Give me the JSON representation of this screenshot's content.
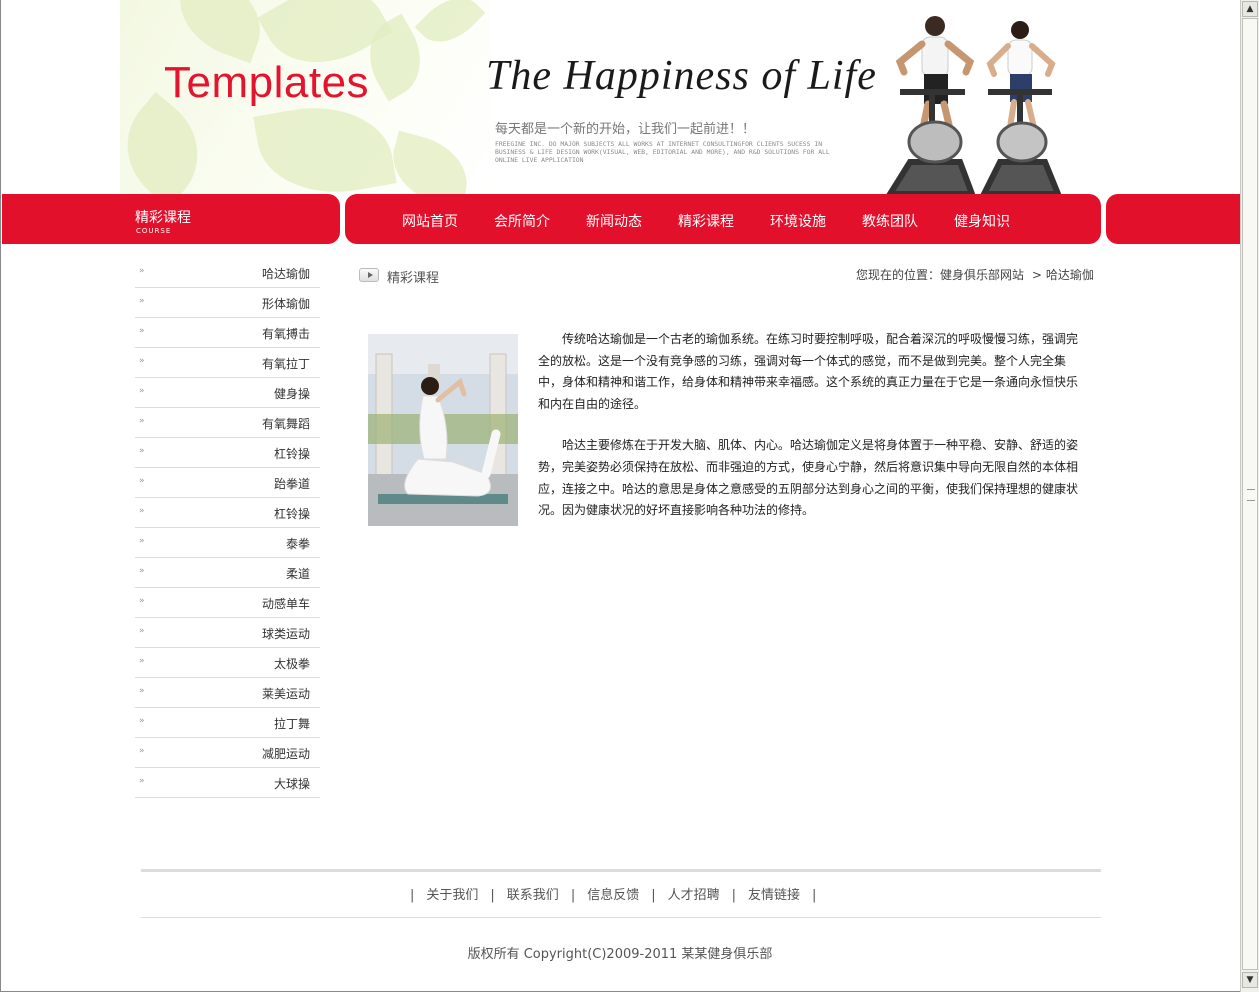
{
  "header": {
    "logo": "Templates",
    "slogan_script": "The Happiness of Life",
    "slogan_cn": "每天都是一个新的开始，让我们一起前进！！",
    "slogan_en": "FREEGINE INC. DO MAJOR SUBJECTS ALL WORKS AT INTERNET CONSULTINGFOR CLIENTS SUCESS IN BUSINESS & LIFE DESIGN WORK(VISUAL, WEB, EDITORIAL AND MORE), AND R&D SOLUTIONS FOR ALL ONLINE LIVE APPLICATION",
    "brand_color": "#e3102c"
  },
  "section": {
    "title": "精彩课程",
    "sub": "COURSE"
  },
  "nav": [
    "网站首页",
    "会所简介",
    "新闻动态",
    "精彩课程",
    "环境设施",
    "教练团队",
    "健身知识"
  ],
  "sidebar": {
    "marker": "»",
    "items": [
      "哈达瑜伽",
      "形体瑜伽",
      "有氧搏击",
      "有氧拉丁",
      "健身操",
      "有氧舞蹈",
      "杠铃操",
      "跆拳道",
      "杠铃操",
      "泰拳",
      "柔道",
      "动感单车",
      "球类运动",
      "太极拳",
      "莱美运动",
      "拉丁舞",
      "减肥运动",
      "大球操"
    ]
  },
  "content": {
    "title": "精彩课程",
    "location_label": "您现在的位置：",
    "location_site": "健身俱乐部网站",
    "location_sep": ">",
    "location_page": "哈达瑜伽",
    "paragraphs": [
      "传统哈达瑜伽是一个古老的瑜伽系统。在练习时要控制呼吸，配合着深沉的呼吸慢慢习练，强调完全的放松。这是一个没有竞争感的习练，强调对每一个体式的感觉，而不是做到完美。整个人完全集中，身体和精神和谐工作，给身体和精神带来幸福感。这个系统的真正力量在于它是一条通向永恒快乐和内在自由的途径。",
      "哈达主要修炼在于开发大脑、肌体、内心。哈达瑜伽定义是将身体置于一种平稳、安静、舒适的姿势，完美姿势必须保持在放松、而非强迫的方式，使身心宁静，然后将意识集中导向无限自然的本体相应，连接之中。哈达的意思是身体之意感受的五阴部分达到身心之间的平衡，使我们保持理想的健康状况。因为健康状况的好坏直接影响各种功法的修持。"
    ]
  },
  "footer": {
    "separator": "|",
    "links": [
      "关于我们",
      "联系我们",
      "信息反馈",
      "人才招聘",
      "友情链接"
    ],
    "copyright": "版权所有 Copyright(C)2009-2011 某某健身俱乐部"
  }
}
